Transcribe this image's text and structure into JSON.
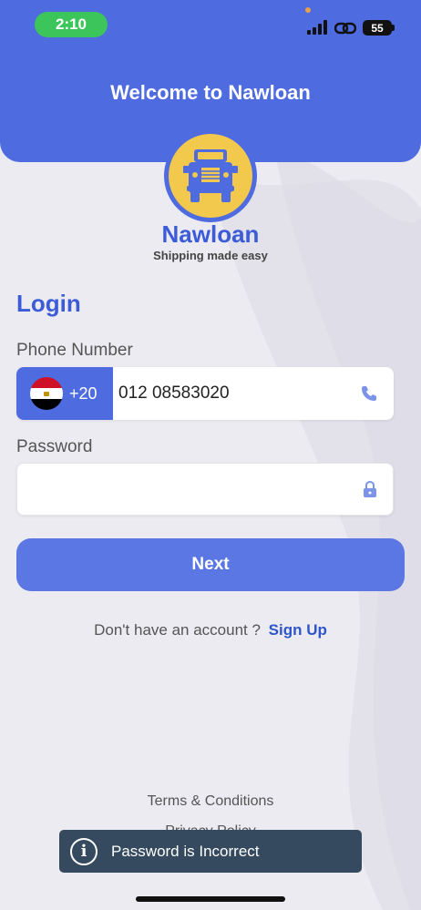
{
  "status_bar": {
    "time": "2:10",
    "battery": "55",
    "signal_icon": "cellular-signal-icon",
    "link_icon": "link-icon"
  },
  "header": {
    "title": "Welcome to Nawloan",
    "color": "#4E6BE0"
  },
  "brand": {
    "name": "Nawloan",
    "tagline": "Shipping made easy",
    "logo_icon": "truck-icon"
  },
  "login": {
    "title": "Login",
    "phone_label": "Phone Number",
    "country_code": "+20",
    "country_flag": "egypt-flag-icon",
    "phone_value": "012 08583020",
    "password_label": "Password",
    "password_value": "",
    "next_label": "Next"
  },
  "signup": {
    "prompt": "Don't have an account ?",
    "link": "Sign Up"
  },
  "footer": {
    "terms": "Terms & Conditions",
    "privacy": "Privacy Policy"
  },
  "toast": {
    "message": "Password is Incorrect",
    "icon": "info-icon"
  },
  "colors": {
    "accent": "#4E6BE0",
    "brand_text": "#3B5BD9",
    "button": "#5B77E3",
    "toast_bg": "#354A5E",
    "status_pill": "#3BC55A"
  }
}
